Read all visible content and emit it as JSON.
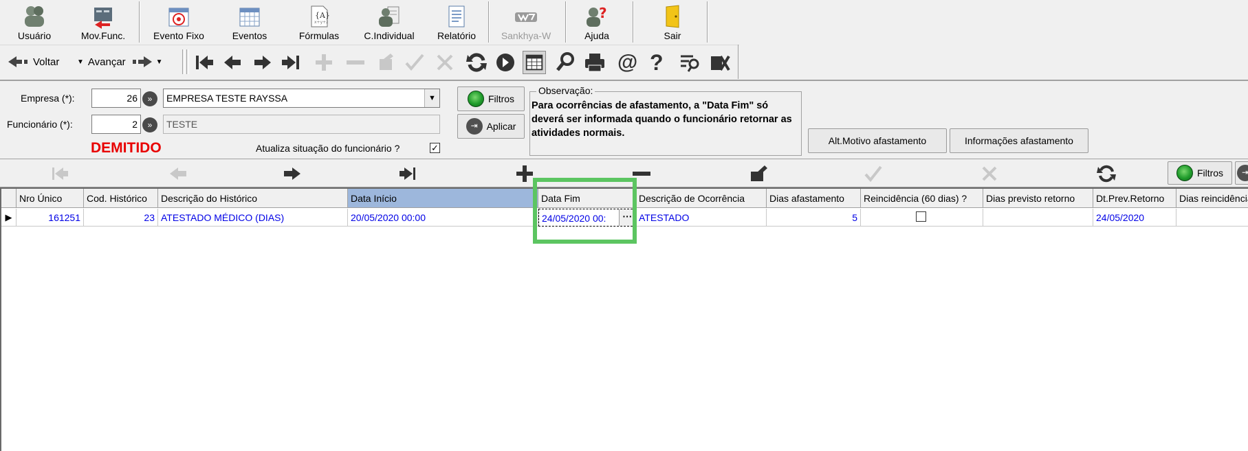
{
  "toolbar": {
    "buttons": [
      {
        "label": "Usuário",
        "icon": "users-icon"
      },
      {
        "label": "Mov.Func.",
        "icon": "employee-transfer-icon"
      },
      {
        "label": "Evento Fixo",
        "icon": "fixed-event-icon"
      },
      {
        "label": "Eventos",
        "icon": "events-calendar-icon"
      },
      {
        "label": "Fórmulas",
        "icon": "formula-icon"
      },
      {
        "label": "C.Individual",
        "icon": "individual-icon"
      },
      {
        "label": "Relatório",
        "icon": "report-icon"
      },
      {
        "label": "Sankhya-W",
        "icon": "sankhya-logo-icon",
        "disabled": true
      },
      {
        "label": "Ajuda",
        "icon": "help-icon"
      },
      {
        "label": "Sair",
        "icon": "exit-icon"
      }
    ]
  },
  "nav": {
    "back_label": "Voltar",
    "forward_label": "Avançar"
  },
  "filters": {
    "empresa_label": "Empresa (*):",
    "empresa_code": "26",
    "empresa_name": "EMPRESA TESTE RAYSSA",
    "funcionario_label": "Funcionário (*):",
    "funcionario_code": "2",
    "funcionario_name": "TESTE",
    "status": "DEMITIDO",
    "atualiza_label": "Atualiza situação do funcionário ?",
    "atualiza_checked": true,
    "filtros_button": "Filtros",
    "aplicar_button": "Aplicar",
    "observacao_label": "Observação:",
    "observacao_text": "Para ocorrências de afastamento, a \"Data Fim\" só deverá ser informada quando o funcionário retornar as atividades normais.",
    "alt_motivo_button": "Alt.Motivo afastamento",
    "info_afastamento_button": "Informações afastamento"
  },
  "grid_nav": {
    "filtros_button": "Filtros"
  },
  "grid": {
    "columns": [
      "Nro Único",
      "Cod. Histórico",
      "Descrição do Histórico",
      "Data Início",
      "Data Fim",
      "Descrição de Ocorrência",
      "Dias afastamento",
      "Reincidência (60 dias) ?",
      "Dias previsto retorno",
      "Dt.Prev.Retorno",
      "Dias reincidência"
    ],
    "sorted_column": "Data Início",
    "rows": [
      {
        "nro_unico": "161251",
        "cod_historico": "23",
        "descricao_historico": "ATESTADO MÉDICO (DIAS)",
        "data_inicio": "20/05/2020 00:00",
        "data_fim": "24/05/2020 00:",
        "descricao_ocorrencia": "ATESTADO",
        "dias_afastamento": "5",
        "reincidencia": false,
        "dias_previsto_retorno": "",
        "dt_prev_retorno": "24/05/2020",
        "dias_reincidencia": ""
      }
    ]
  },
  "colors": {
    "highlight": "#5cc561",
    "sorted_header": "#9db7dc",
    "cell_text": "#0000e6",
    "status_red": "#e80000"
  }
}
